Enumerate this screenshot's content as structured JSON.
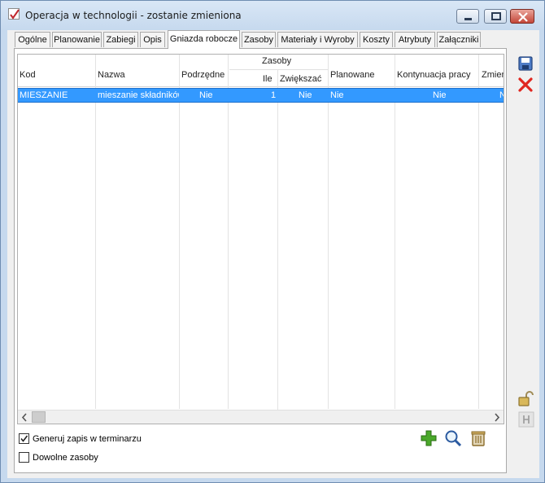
{
  "window": {
    "title": "Operacja w technologii - zostanie zmieniona"
  },
  "tabs": [
    {
      "label": "Ogólne"
    },
    {
      "label": "Planowanie"
    },
    {
      "label": "Zabiegi"
    },
    {
      "label": "Opis"
    },
    {
      "label": "Gniazda robocze",
      "active": true
    },
    {
      "label": "Zasoby"
    },
    {
      "label": "Materiały i Wyroby"
    },
    {
      "label": "Koszty"
    },
    {
      "label": "Atrybuty"
    },
    {
      "label": "Załączniki"
    }
  ],
  "grid": {
    "columns": {
      "kod": "Kod",
      "nazwa": "Nazwa",
      "podrzedne": "Podrzędne",
      "zasoby_group": "Zasoby",
      "ile": "Ile",
      "zwiekszac": "Zwiększać",
      "planowane": "Planowane",
      "kontynuacja": "Kontynuacja pracy",
      "zmienne": "Zmienn"
    },
    "rows": [
      {
        "kod": "MIESZANIE",
        "nazwa": "mieszanie składników",
        "podrzedne": "Nie",
        "ile": "1",
        "zwiekszac": "Nie",
        "planowane": "Nie",
        "kontynuacja": "Nie",
        "zmienne": "N"
      }
    ]
  },
  "options": {
    "generuj_label": "Generuj zapis w terminarzu",
    "generuj_checked": true,
    "dowolne_label": "Dowolne zasoby",
    "dowolne_checked": false
  },
  "icons": {
    "save": "save-icon",
    "cancel": "close-x-icon",
    "add": "plus-icon",
    "view": "magnifier-icon",
    "delete": "trash-icon",
    "lock": "padlock-icon",
    "unlink": "unlink-icon"
  }
}
